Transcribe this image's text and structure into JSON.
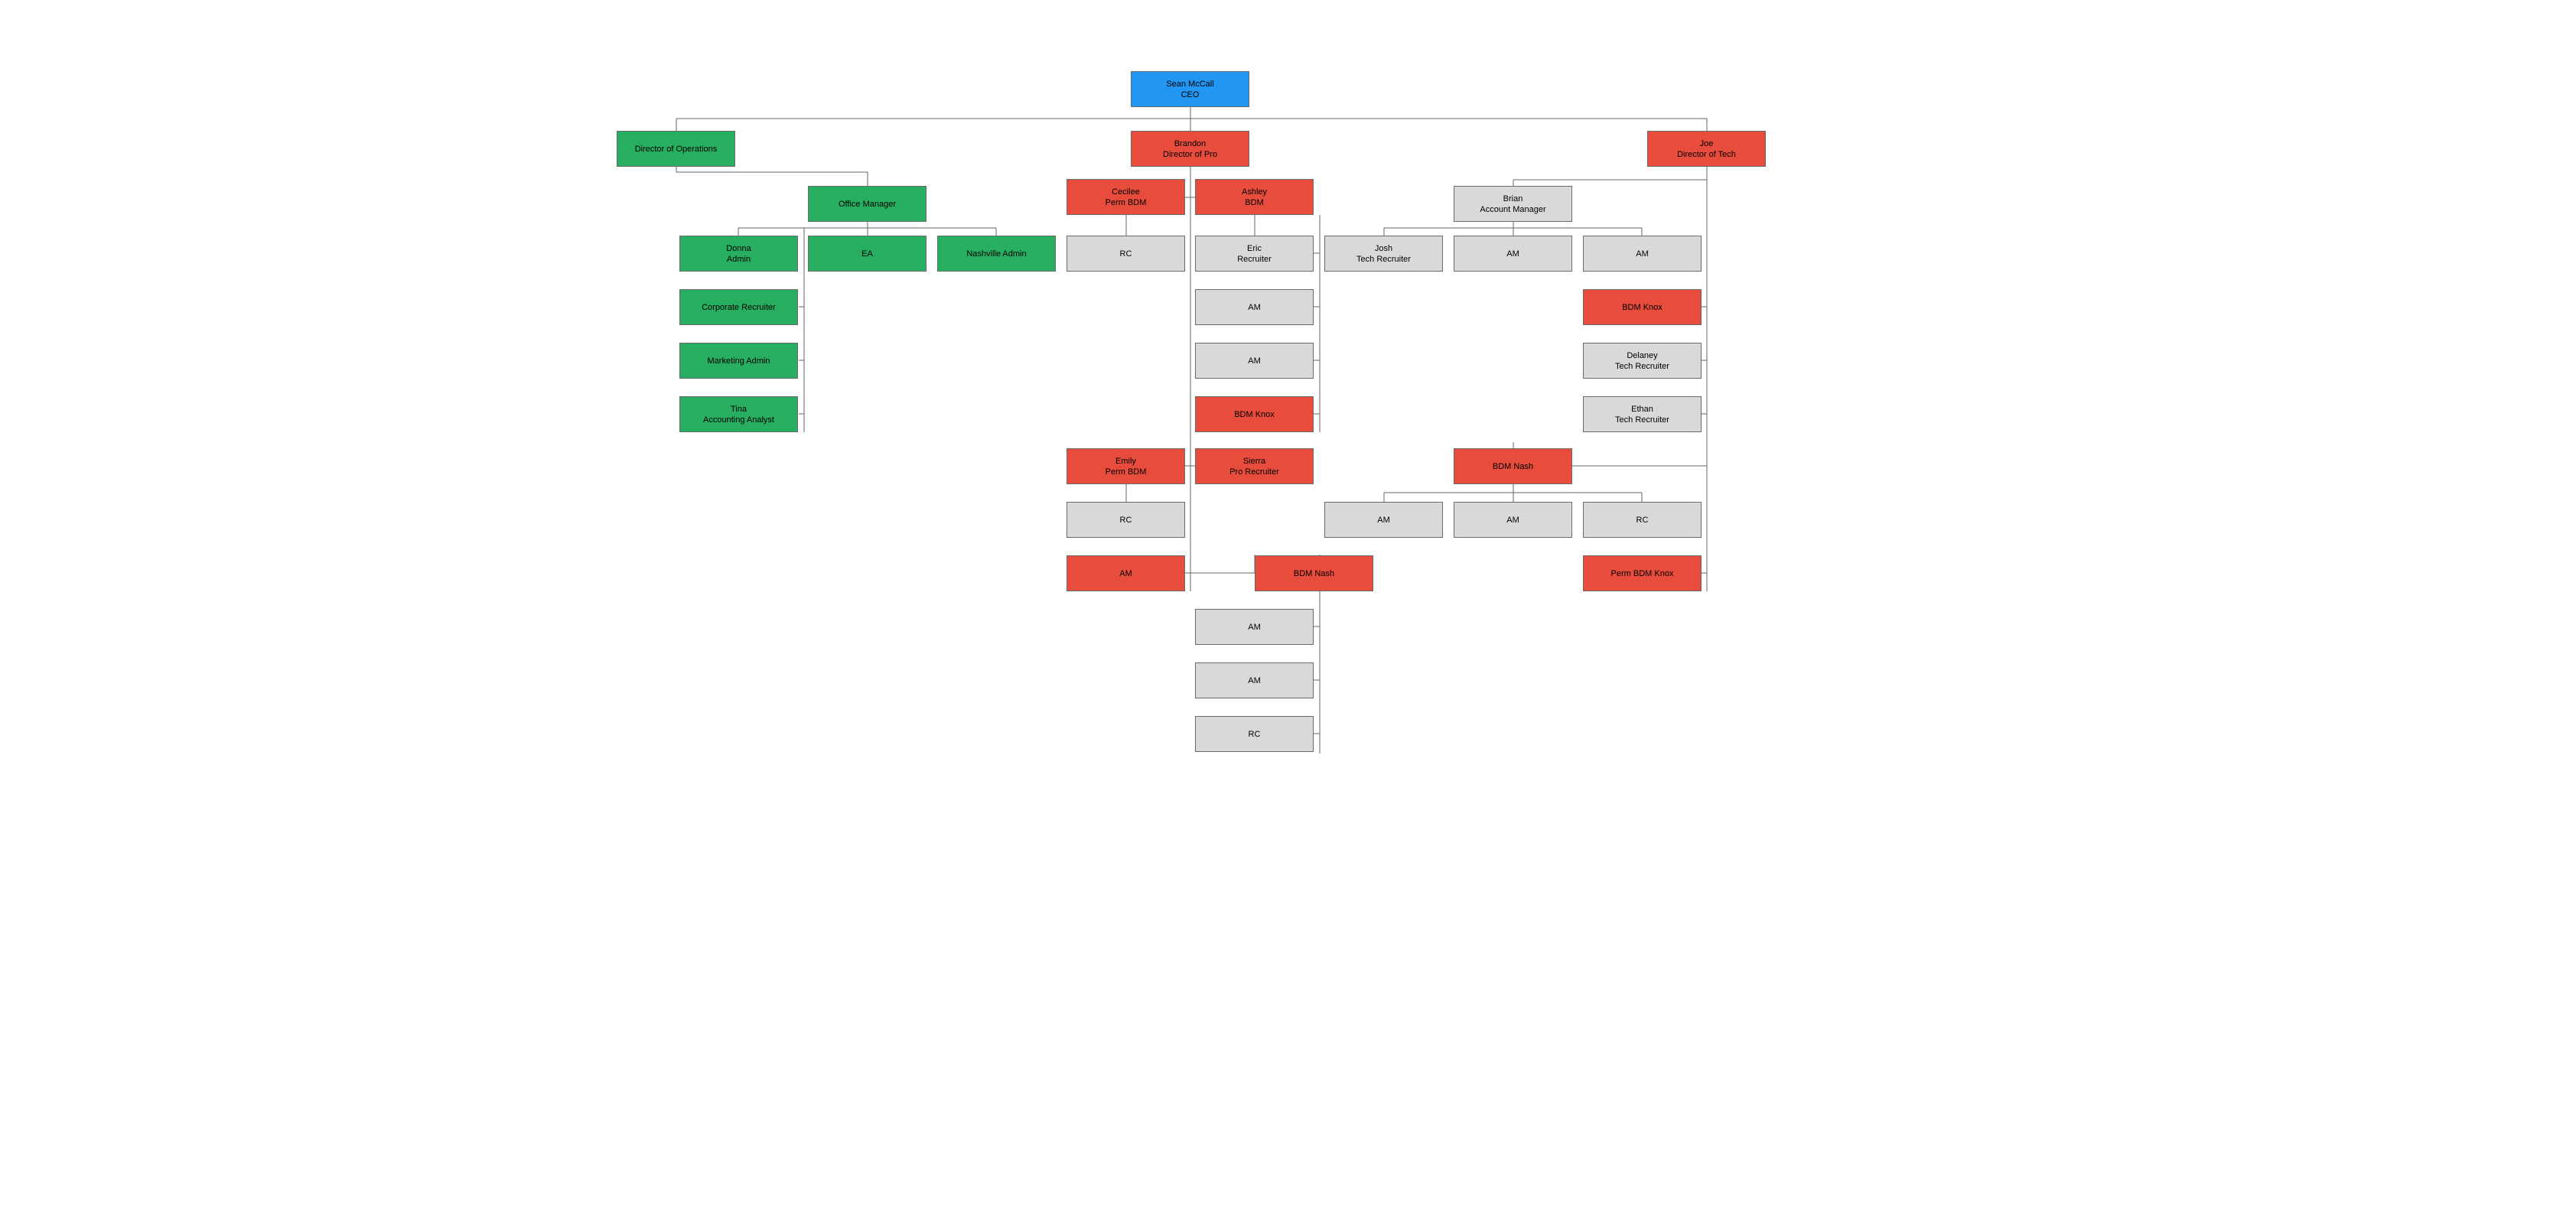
{
  "colors": {
    "blue": "#2196f3",
    "red": "#e84c3d",
    "green": "#27ae60",
    "grey": "#d9d9d9"
  },
  "nodes": {
    "ceo": {
      "name": "Sean McCall",
      "title": "CEO"
    },
    "dir_ops": {
      "name": "",
      "title": "Director of Operations"
    },
    "dir_pro": {
      "name": "Brandon",
      "title": "Director of Pro"
    },
    "dir_tech": {
      "name": "Joe",
      "title": "Director of Tech"
    },
    "office_mgr": {
      "name": "",
      "title": "Office Manager"
    },
    "donna": {
      "name": "Donna",
      "title": "Admin"
    },
    "ea": {
      "name": "",
      "title": "EA"
    },
    "nash_admin": {
      "name": "",
      "title": "Nashville Admin"
    },
    "corp_rec": {
      "name": "",
      "title": "Corporate Recruiter"
    },
    "mkt_admin": {
      "name": "",
      "title": "Marketing Admin"
    },
    "tina": {
      "name": "Tina",
      "title": "Accounting Analyst"
    },
    "cecilee": {
      "name": "Cecilee",
      "title": "Perm BDM"
    },
    "cecilee_rc": {
      "name": "",
      "title": "RC"
    },
    "ashley": {
      "name": "Ashley",
      "title": "BDM"
    },
    "eric": {
      "name": "Eric",
      "title": "Recruiter"
    },
    "ashley_am1": {
      "name": "",
      "title": "AM"
    },
    "ashley_am2": {
      "name": "",
      "title": "AM"
    },
    "ashley_bdmknox": {
      "name": "",
      "title": "BDM Knox"
    },
    "emily": {
      "name": "Emily",
      "title": "Perm BDM"
    },
    "emily_rc": {
      "name": "",
      "title": "RC"
    },
    "sierra": {
      "name": "Sierra",
      "title": "Pro Recruiter"
    },
    "brandon_am": {
      "name": "",
      "title": "AM"
    },
    "bdm_nash_b": {
      "name": "",
      "title": "BDM Nash"
    },
    "bnash_am1": {
      "name": "",
      "title": "AM"
    },
    "bnash_am2": {
      "name": "",
      "title": "AM"
    },
    "bnash_rc": {
      "name": "",
      "title": "RC"
    },
    "brian": {
      "name": "Brian",
      "title": "Account Manager"
    },
    "josh": {
      "name": "Josh",
      "title": "Tech Recruiter"
    },
    "brian_am1": {
      "name": "",
      "title": "AM"
    },
    "brian_am2": {
      "name": "",
      "title": "AM"
    },
    "brian_bdmknox": {
      "name": "",
      "title": "BDM Knox"
    },
    "delaney": {
      "name": "Delaney",
      "title": "Tech Recruiter"
    },
    "ethan": {
      "name": "Ethan",
      "title": "Tech Recruiter"
    },
    "bdm_nash_t": {
      "name": "",
      "title": "BDM Nash"
    },
    "tnash_am1": {
      "name": "",
      "title": "AM"
    },
    "tnash_am2": {
      "name": "",
      "title": "AM"
    },
    "tnash_rc": {
      "name": "",
      "title": "RC"
    },
    "perm_bdm_knox": {
      "name": "",
      "title": "Perm BDM Knox"
    }
  }
}
